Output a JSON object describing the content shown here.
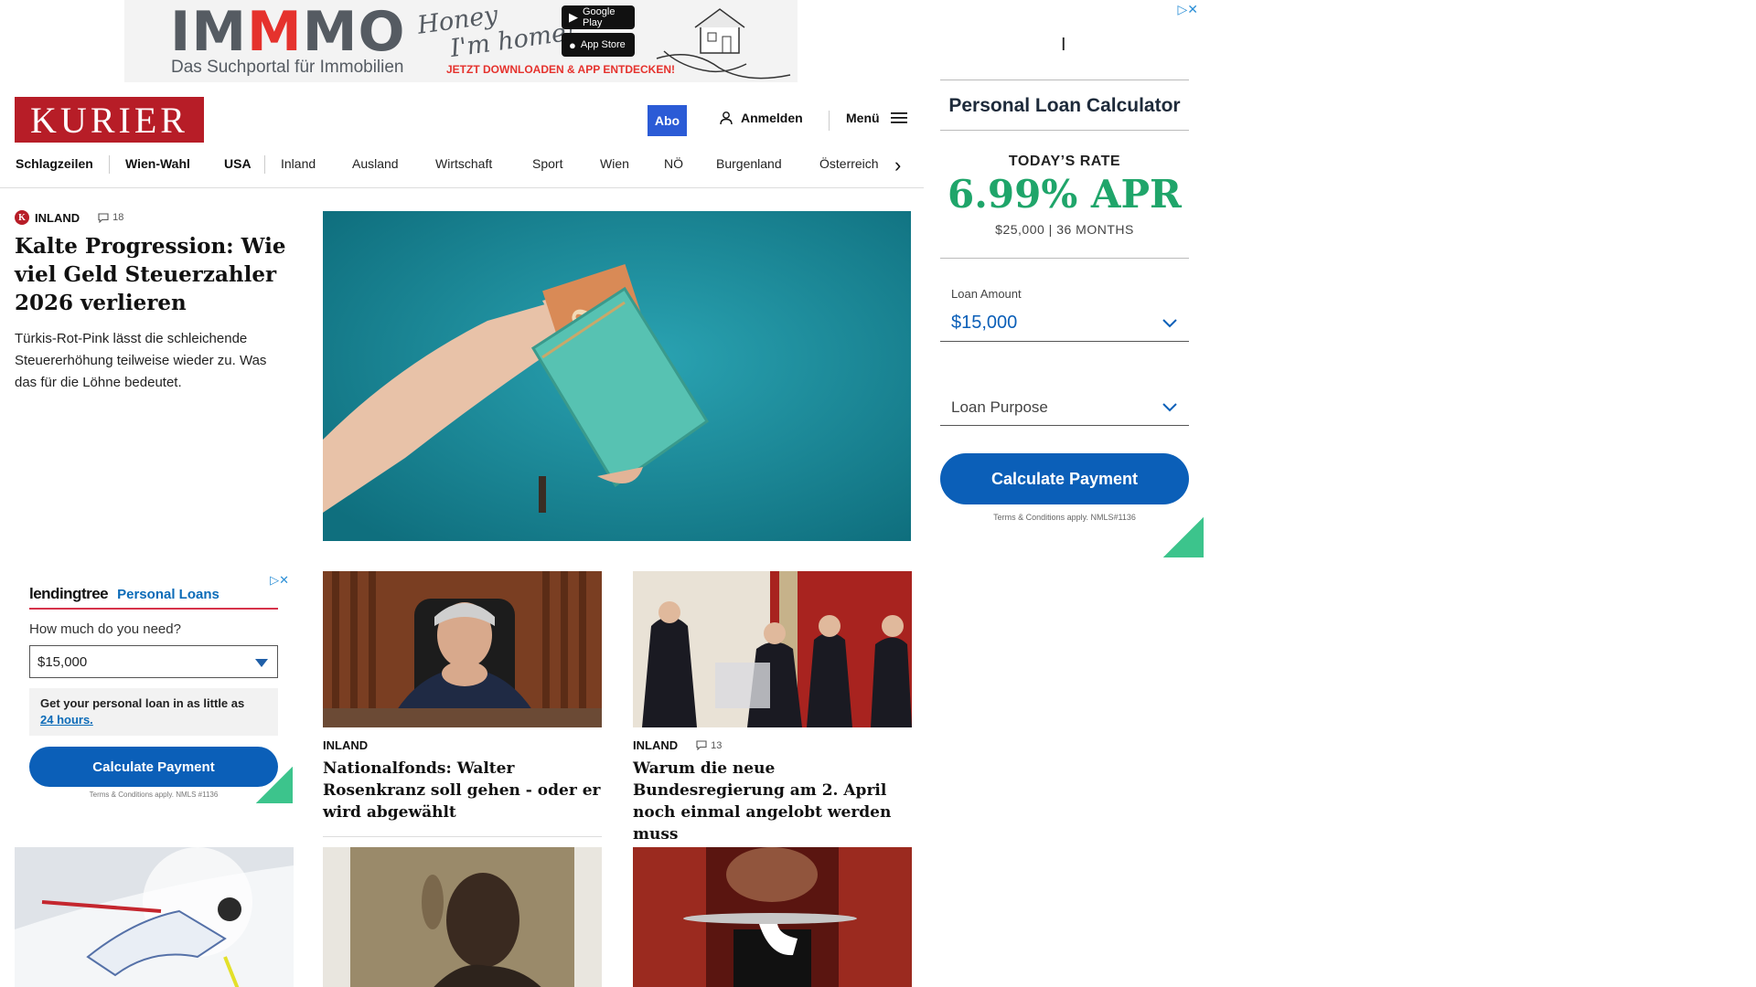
{
  "top_ad": {
    "brand_prefix": "IM",
    "brand_accent": "M",
    "brand_suffix": "MO",
    "tagline": "Das Suchportal für Immobilien",
    "script_line1": "Honey",
    "script_line2": "I'm home!",
    "google_play": "Google Play",
    "app_store": "App Store",
    "cta": "JETZT DOWNLOADEN & APP ENTDECKEN!"
  },
  "header": {
    "logo": "KURIER",
    "abo": "Abo",
    "login": "Anmelden",
    "menu": "Menü"
  },
  "nav": {
    "items": [
      "Schlagzeilen",
      "Wien-Wahl",
      "USA",
      "Inland",
      "Ausland",
      "Wirtschaft",
      "Sport",
      "Wien",
      "NÖ",
      "Burgenland",
      "Österreich"
    ]
  },
  "lead": {
    "badge": "K",
    "section": "INLAND",
    "comments": "18",
    "headline": "Kalte Progression: Wie viel Geld Steuerzahler 2026 verlieren",
    "teaser": "Türkis-Rot-Pink lässt die schleichende Steuererhöhung teilweise wieder zu. Was das für die Löhne bedeutet."
  },
  "lt_ad": {
    "logo": "lendingtree",
    "title": "Personal Loans",
    "question": "How much do you need?",
    "amount": "$15,000",
    "info": "Get your personal loan in as little as",
    "info_link": "24 hours.",
    "button": "Calculate Payment",
    "terms": "Terms & Conditions apply. NMLS #1136"
  },
  "articles": [
    {
      "section": "INLAND",
      "comments": "",
      "headline": "Nationalfonds: Walter Rosenkranz soll gehen - oder er wird abgewählt"
    },
    {
      "section": "INLAND",
      "comments": "13",
      "headline": "Warum die neue Bundesregierung am 2. April noch einmal angelobt werden muss"
    }
  ],
  "calc_ad": {
    "cursor": "I",
    "title": "Personal Loan Calculator",
    "rate_label": "TODAY’S RATE",
    "rate": "6.99% APR",
    "rate_sub": "$25,000 | 36 MONTHS",
    "amount_label": "Loan Amount",
    "amount": "$15,000",
    "purpose": "Loan Purpose",
    "button": "Calculate Payment",
    "terms": "Terms & Conditions apply. NMLS#1136"
  },
  "colors": {
    "brand_red": "#b71d27",
    "abo_blue": "#2b5bd6",
    "ad_blue": "#0b5fb8",
    "rate_green": "#1fa56a"
  }
}
